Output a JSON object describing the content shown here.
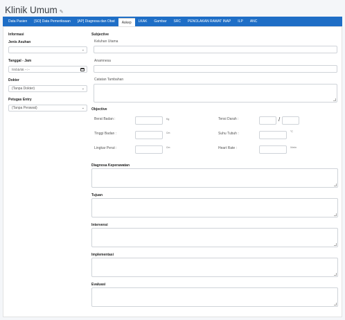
{
  "page": {
    "title": "Klinik Umum"
  },
  "tabs": [
    {
      "label": "Data Pasien"
    },
    {
      "label": "[SO] Data Pemeriksaan"
    },
    {
      "label": "[AP] Diagnosa dan Obat"
    },
    {
      "label": "Askep"
    },
    {
      "label": "LKAK"
    },
    {
      "label": "Gambar"
    },
    {
      "label": "SRC"
    },
    {
      "label": "PENOLAKAN RAWAT INAP"
    },
    {
      "label": "ILP"
    },
    {
      "label": "ANC"
    }
  ],
  "active_tab": "Askep",
  "left": {
    "informasi": "Informasi",
    "jenis_asuhan": {
      "label": "Jenis Asuhan",
      "value": ""
    },
    "tanggal_jam": {
      "label": "Tanggal - Jam",
      "placeholder": "hh/bb/tttt --:--"
    },
    "dokter": {
      "label": "Dokter",
      "value": "(Tanpa Dokter)"
    },
    "petugas": {
      "label": "Petugas Entry",
      "value": "(Tanpa Perawat)"
    }
  },
  "subjective": {
    "heading": "Subjective",
    "keluhan": "Keluhan Utama",
    "anamnesa": "Anamnesa",
    "catatan": "Catatan Tambahan"
  },
  "objective": {
    "heading": "Objective",
    "berat": {
      "label": "Berat Badan :",
      "unit": "Kg"
    },
    "tinggi": {
      "label": "Tinggi Badan :",
      "unit": "Cm"
    },
    "lingkar": {
      "label": "Lingkar Perut :",
      "unit": "Cm"
    },
    "tensi": {
      "label": "Tensi Darah :",
      "sep": "/"
    },
    "suhu": {
      "label": "Suhu Tubuh :",
      "unit": "°C"
    },
    "heart": {
      "label": "Heart Rate :",
      "unit": "X/min"
    }
  },
  "sections": {
    "diagnosa": "Diagnosa Keperawatan",
    "tujuan": "Tujuan",
    "intervensi": "Intervensi",
    "implementasi": "Implementasi",
    "evaluasi": "Evaluasi"
  },
  "colors": {
    "tabbar": "#1e6ec6",
    "panel": "#ffffff",
    "background": "#f4f6f9"
  },
  "icons": {
    "title": "pencil-icon",
    "date": "calendar-icon",
    "select": "chevron-down-icon"
  }
}
